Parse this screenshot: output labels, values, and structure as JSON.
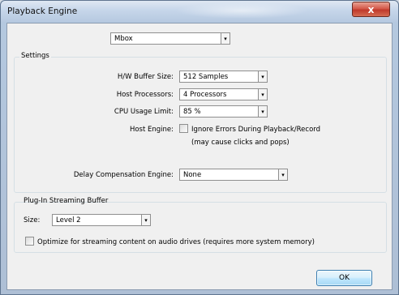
{
  "window": {
    "title": "Playback Engine",
    "close_symbol": "x"
  },
  "device": {
    "selected": "Mbox"
  },
  "settings": {
    "group_label": "Settings",
    "hw_buffer_label": "H/W Buffer Size:",
    "hw_buffer_value": "512 Samples",
    "host_processors_label": "Host Processors:",
    "host_processors_value": "4 Processors",
    "cpu_usage_label": "CPU Usage Limit:",
    "cpu_usage_value": "85 %",
    "host_engine_label": "Host Engine:",
    "ignore_errors_label": "Ignore Errors During Playback/Record",
    "ignore_errors_checked": false,
    "ignore_errors_note": "(may cause clicks and pops)",
    "delay_comp_label": "Delay Compensation Engine:",
    "delay_comp_value": "None"
  },
  "plugin_buffer": {
    "group_label": "Plug-In Streaming Buffer",
    "size_label": "Size:",
    "size_value": "Level 2",
    "optimize_label": "Optimize for streaming content on audio drives (requires more system memory)",
    "optimize_checked": false
  },
  "footer": {
    "ok_label": "OK"
  },
  "icons": {
    "dropdown_arrow": "▾"
  }
}
